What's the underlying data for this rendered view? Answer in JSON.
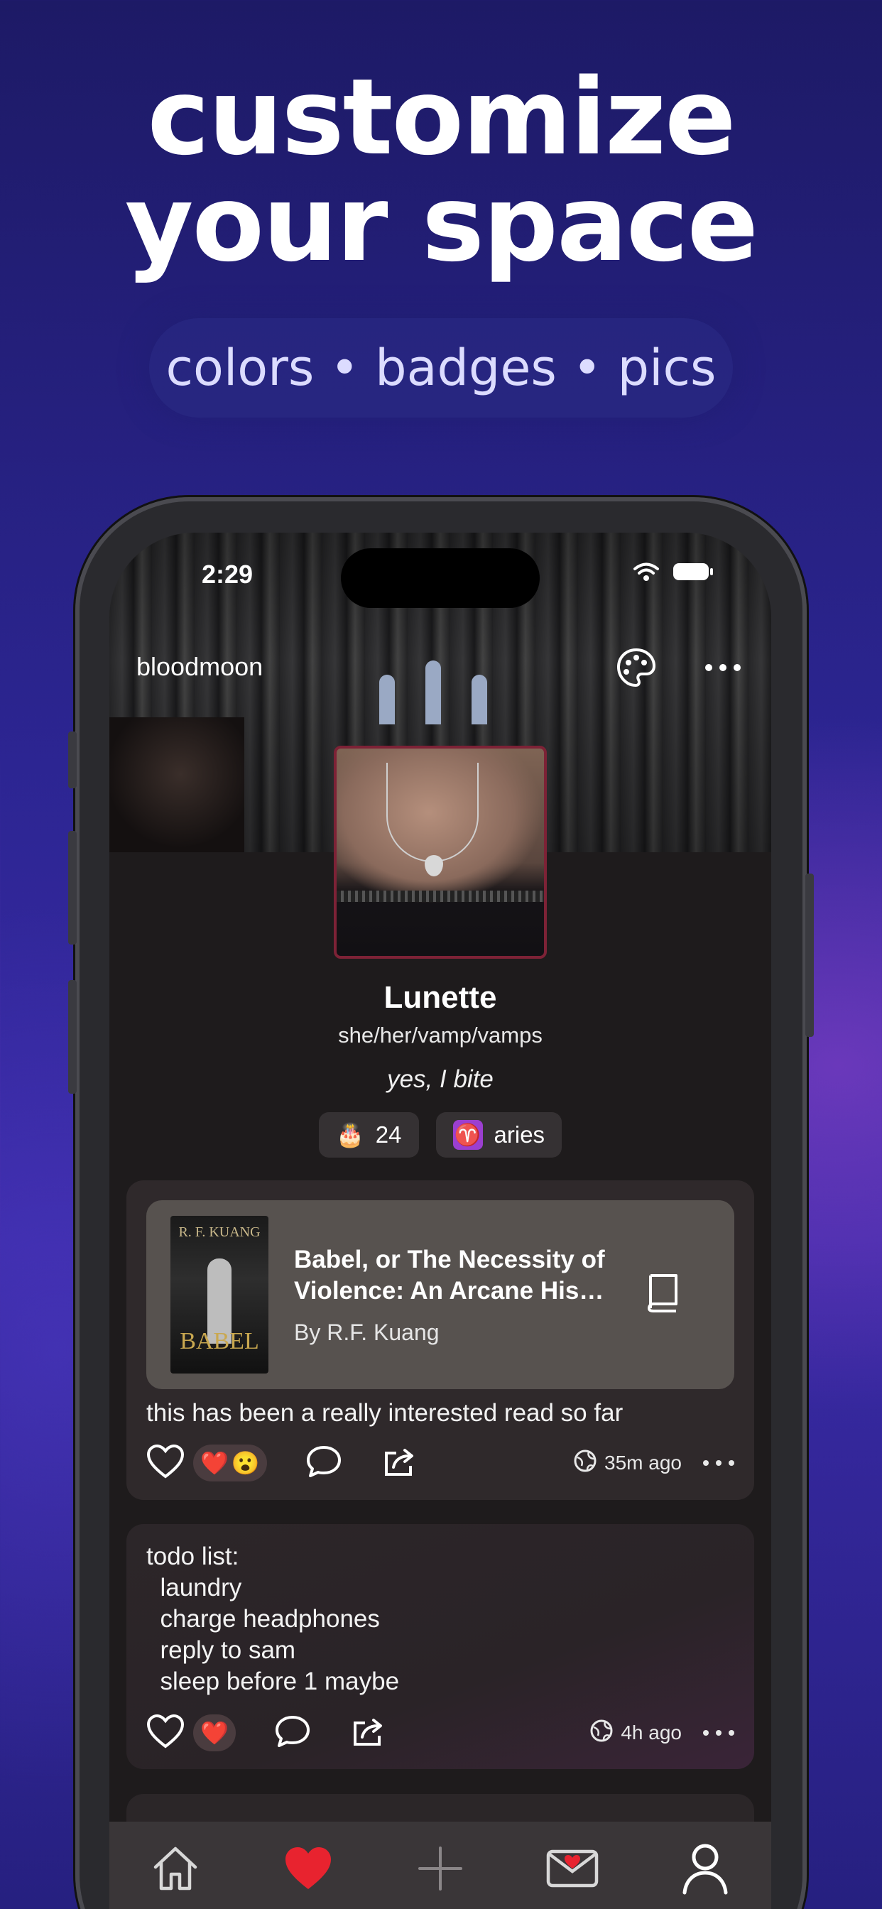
{
  "promo": {
    "headline_line1": "customize",
    "headline_line2": "your space",
    "tagline": "colors • badges • pics"
  },
  "status_bar": {
    "time": "2:29"
  },
  "profile": {
    "username": "bloodmoon",
    "display_name": "Lunette",
    "pronouns": "she/her/vamp/vamps",
    "bio": "yes, I bite",
    "badges": [
      {
        "icon": "🎂",
        "label": "24"
      },
      {
        "icon": "♈",
        "label": "aries"
      }
    ]
  },
  "posts": [
    {
      "book": {
        "title": "Babel, or The Necessity of Violence: An Arcane His…",
        "author": "By R.F. Kuang",
        "cover_author": "R. F. KUANG",
        "cover_title": "BABEL"
      },
      "text": "this has been a really interested read so far",
      "reactions": [
        "❤️",
        "😮"
      ],
      "timestamp": "35m ago"
    },
    {
      "text": "todo list:\n  laundry\n  charge headphones\n  reply to sam\n  sleep before 1 maybe",
      "reactions": [
        "❤️"
      ],
      "timestamp": "4h ago"
    }
  ],
  "colors": {
    "accent_heart": "#e8232f",
    "avatar_border": "#7d2236",
    "aries_badge": "#9b3fd0"
  },
  "tabbar": {
    "items": [
      "home-icon",
      "heart-icon",
      "plus-icon",
      "mail-heart-icon",
      "profile-icon"
    ],
    "active": "profile-icon"
  }
}
